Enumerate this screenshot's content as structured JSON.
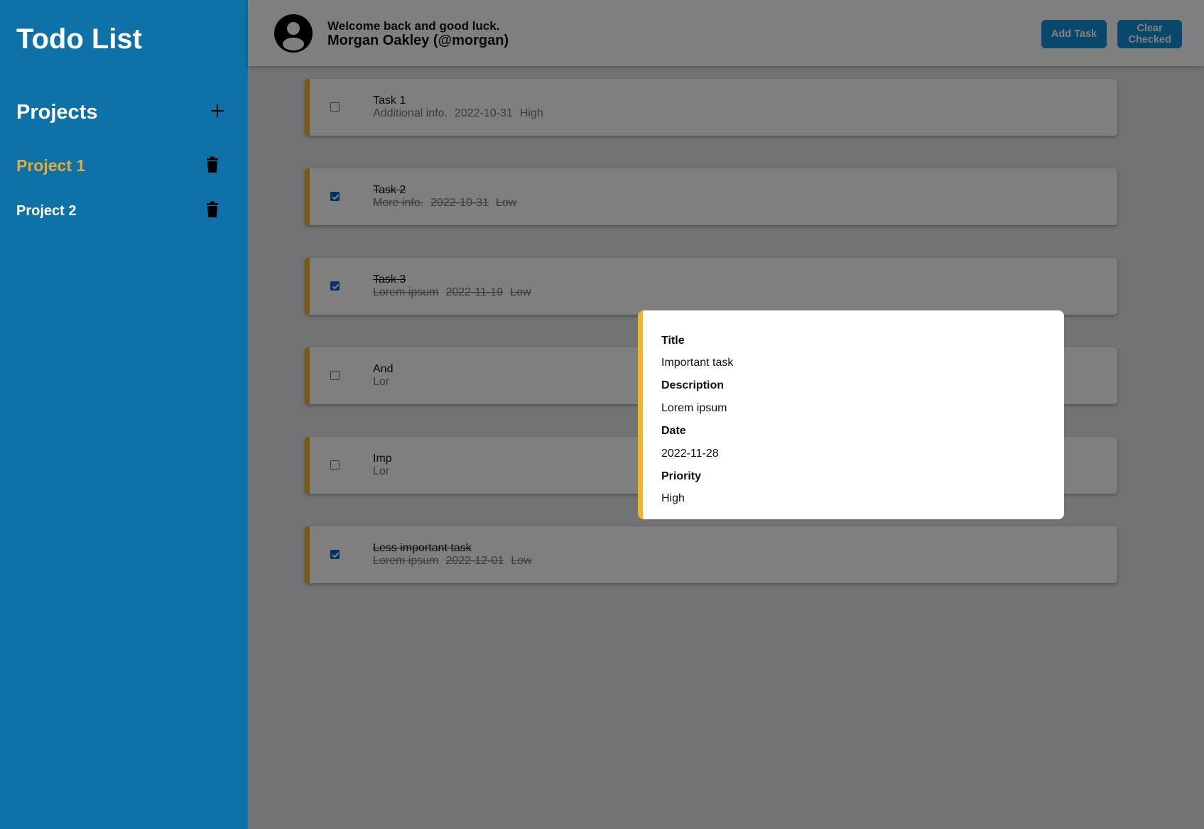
{
  "app": {
    "title": "Todo List"
  },
  "sidebar": {
    "projects_label": "Projects",
    "projects": [
      {
        "name": "Project 1",
        "active": true
      },
      {
        "name": "Project 2",
        "active": false
      }
    ]
  },
  "header": {
    "welcome": "Welcome back and good luck.",
    "user": "Morgan Oakley (@morgan)",
    "add_task_label": "Add Task",
    "clear_checked_label": "Clear Checked"
  },
  "tasks": [
    {
      "title": "Task 1",
      "description": "Additional info.",
      "date": "2022-10-31",
      "priority": "High",
      "checked": false
    },
    {
      "title": "Task 2",
      "description": "More info.",
      "date": "2022-10-31",
      "priority": "Low",
      "checked": true
    },
    {
      "title": "Task 3",
      "description": "Lorem ipsum",
      "date": "2022-11-19",
      "priority": "Low",
      "checked": true
    },
    {
      "title": "And",
      "description": "Lor",
      "date": "",
      "priority": "",
      "checked": false
    },
    {
      "title": "Imp",
      "description": "Lor",
      "date": "",
      "priority": "",
      "checked": false
    },
    {
      "title": "Less important task",
      "description": "Lorem ipsum",
      "date": "2022-12-01",
      "priority": "Low",
      "checked": true
    }
  ],
  "modal": {
    "title_label": "Title",
    "title_value": "Important task",
    "description_label": "Description",
    "description_value": "Lorem ipsum",
    "date_label": "Date",
    "date_value": "2022-11-28",
    "priority_label": "Priority",
    "priority_value": "High"
  },
  "colors": {
    "sidebar": "#0e71a8",
    "accent": "#f3b42b",
    "active_project": "#e6a93a",
    "button": "#1591d6"
  },
  "icons": {
    "add_project": "plus-icon",
    "delete_project": "trash-icon",
    "avatar": "user-circle-icon"
  }
}
